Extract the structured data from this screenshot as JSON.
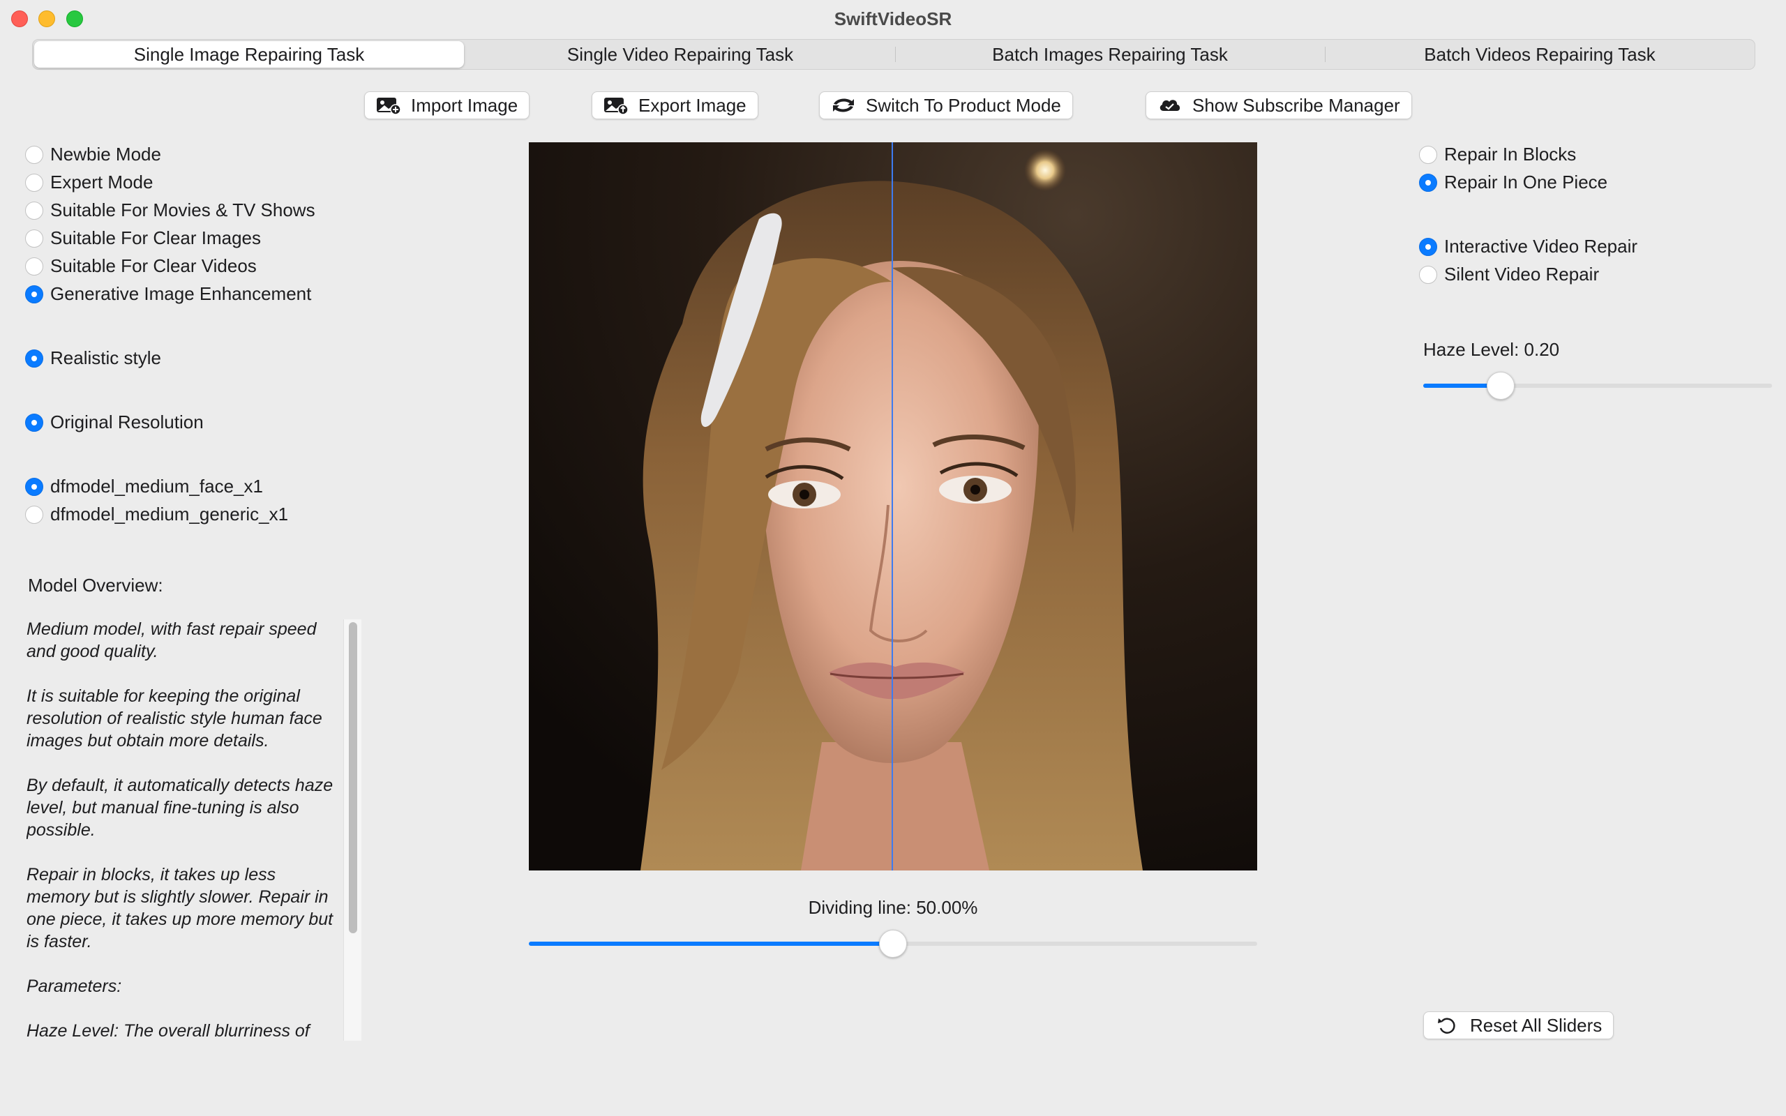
{
  "window": {
    "title": "SwiftVideoSR"
  },
  "tabs": [
    {
      "label": "Single Image Repairing Task",
      "active": true
    },
    {
      "label": "Single Video Repairing Task",
      "active": false
    },
    {
      "label": "Batch Images Repairing Task",
      "active": false
    },
    {
      "label": "Batch Videos Repairing Task",
      "active": false
    }
  ],
  "toolbar": {
    "import_label": "Import Image",
    "export_label": "Export Image",
    "switch_label": "Switch To Product Mode",
    "subscribe_label": "Show Subscribe Manager"
  },
  "modes": [
    {
      "label": "Newbie Mode",
      "selected": false
    },
    {
      "label": "Expert Mode",
      "selected": false
    },
    {
      "label": "Suitable For Movies & TV Shows",
      "selected": false
    },
    {
      "label": "Suitable For Clear Images",
      "selected": false
    },
    {
      "label": "Suitable For Clear Videos",
      "selected": false
    },
    {
      "label": "Generative Image Enhancement",
      "selected": true
    }
  ],
  "style": {
    "label": "Realistic style",
    "selected": true
  },
  "resolution": {
    "label": "Original Resolution",
    "selected": true
  },
  "models": [
    {
      "label": "dfmodel_medium_face_x1",
      "selected": true
    },
    {
      "label": "dfmodel_medium_generic_x1",
      "selected": false
    }
  ],
  "overview": {
    "title": "Model Overview:",
    "paragraphs": [
      "Medium model, with fast repair speed and good quality.",
      "It is suitable for keeping the original resolution of realistic style human face images but obtain more details.",
      "By default, it automatically detects haze level, but manual fine-tuning is also possible.",
      "Repair in blocks, it takes up less memory but is slightly slower. Repair in one piece, it takes up more memory but is faster.",
      "Parameters:",
      "Haze Level: The overall blurriness of"
    ]
  },
  "repair_options": [
    {
      "label": "Repair In Blocks",
      "selected": false
    },
    {
      "label": "Repair In One Piece",
      "selected": true
    }
  ],
  "video_options": [
    {
      "label": "Interactive Video Repair",
      "selected": true
    },
    {
      "label": "Silent Video Repair",
      "selected": false
    }
  ],
  "haze": {
    "label": "Haze Level: 0.20",
    "value": 0.2
  },
  "dividing": {
    "label": "Dividing line: 50.00%",
    "value": 0.5
  },
  "reset_label": "Reset All Sliders",
  "colors": {
    "accent": "#0a7bff",
    "divider": "#3d7bf0",
    "background": "#ececec"
  },
  "icons": {
    "import": "photo-plus-icon",
    "export": "photo-export-icon",
    "switch": "swap-icon",
    "subscribe": "cloud-icon",
    "reset": "reset-arrow-icon"
  }
}
